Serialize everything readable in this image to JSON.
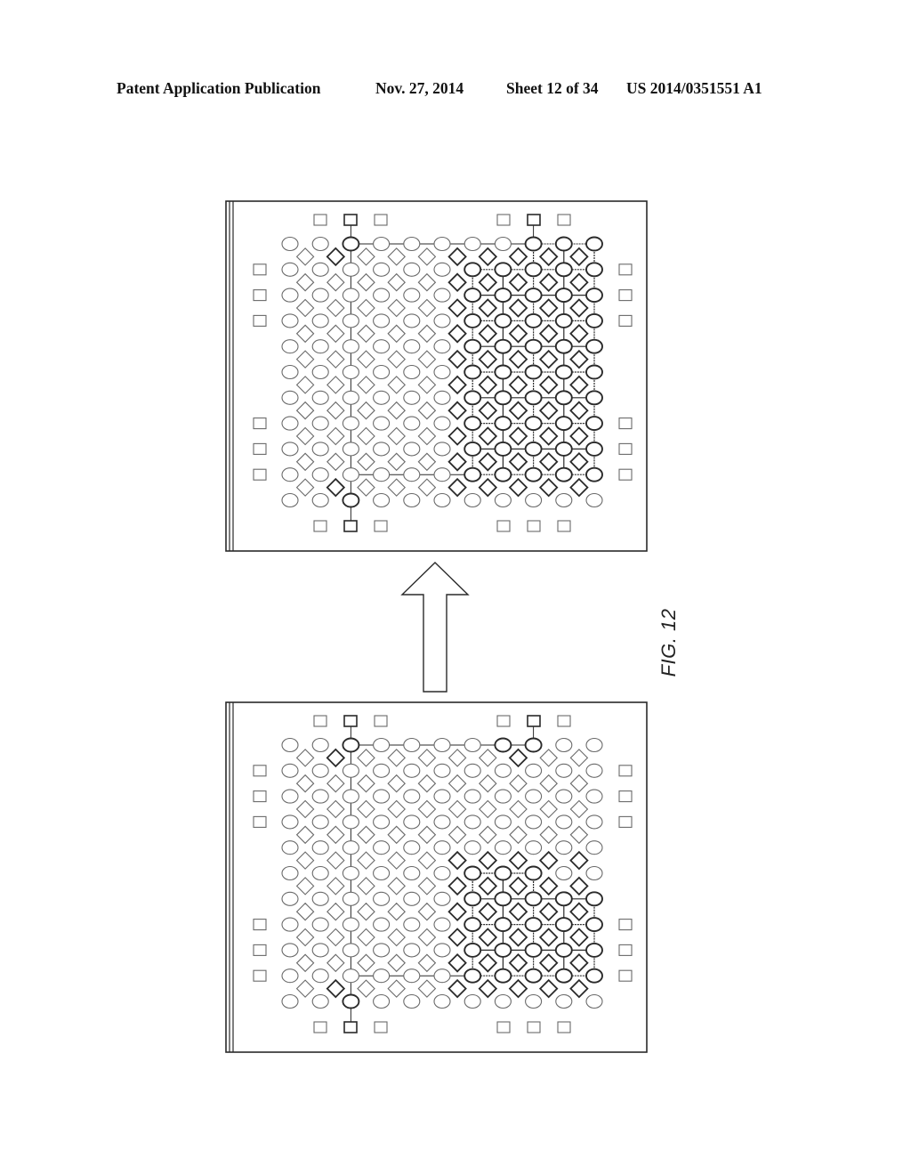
{
  "header": {
    "publication": "Patent Application Publication",
    "date": "Nov. 27, 2014",
    "sheet": "Sheet 12 of 34",
    "number": "US 2014/0351551 A1"
  },
  "figure": {
    "label": "FIG. 12",
    "arrow_direction": "up",
    "arrow_meaning": "lower panel transitions to upper panel",
    "grid": {
      "circle_rows": 11,
      "circle_cols": 11,
      "diamond_rows": 10,
      "diamond_cols": 10,
      "top_pads_left": 3,
      "top_pads_right": 3,
      "bottom_pads_left": 3,
      "bottom_pads_right": 3,
      "side_pad_rows": [
        2,
        3,
        4,
        8,
        9,
        10
      ]
    },
    "panels": [
      {
        "name": "upper-panel",
        "state": "after",
        "bold_circles": [
          [
            1,
            3
          ],
          [
            1,
            9
          ],
          [
            1,
            10
          ],
          [
            1,
            11
          ],
          [
            2,
            7
          ],
          [
            2,
            8
          ],
          [
            2,
            9
          ],
          [
            2,
            10
          ],
          [
            2,
            11
          ],
          [
            3,
            7
          ],
          [
            3,
            8
          ],
          [
            3,
            9
          ],
          [
            3,
            10
          ],
          [
            3,
            11
          ],
          [
            4,
            7
          ],
          [
            4,
            8
          ],
          [
            4,
            9
          ],
          [
            4,
            10
          ],
          [
            4,
            11
          ],
          [
            5,
            7
          ],
          [
            5,
            8
          ],
          [
            5,
            9
          ],
          [
            5,
            10
          ],
          [
            5,
            11
          ],
          [
            6,
            7
          ],
          [
            6,
            8
          ],
          [
            6,
            9
          ],
          [
            6,
            10
          ],
          [
            6,
            11
          ],
          [
            7,
            7
          ],
          [
            7,
            8
          ],
          [
            7,
            9
          ],
          [
            7,
            10
          ],
          [
            7,
            11
          ],
          [
            8,
            7
          ],
          [
            8,
            8
          ],
          [
            8,
            9
          ],
          [
            8,
            10
          ],
          [
            8,
            11
          ],
          [
            9,
            7
          ],
          [
            9,
            8
          ],
          [
            9,
            9
          ],
          [
            9,
            10
          ],
          [
            9,
            11
          ],
          [
            10,
            7
          ],
          [
            10,
            8
          ],
          [
            10,
            9
          ],
          [
            10,
            10
          ],
          [
            10,
            11
          ],
          [
            11,
            3
          ]
        ],
        "mesh_region": {
          "row_from": 2,
          "row_to": 10,
          "col_from": 7,
          "col_to": 11
        },
        "bold_pads_top": [
          2,
          5
        ],
        "bold_pads_bottom": [
          2
        ]
      },
      {
        "name": "lower-panel",
        "state": "before",
        "bold_circles": [
          [
            1,
            3
          ],
          [
            1,
            8
          ],
          [
            1,
            9
          ],
          [
            6,
            7
          ],
          [
            6,
            8
          ],
          [
            6,
            9
          ],
          [
            7,
            7
          ],
          [
            7,
            8
          ],
          [
            7,
            9
          ],
          [
            7,
            10
          ],
          [
            7,
            11
          ],
          [
            8,
            7
          ],
          [
            8,
            8
          ],
          [
            8,
            9
          ],
          [
            8,
            10
          ],
          [
            8,
            11
          ],
          [
            9,
            7
          ],
          [
            9,
            8
          ],
          [
            9,
            9
          ],
          [
            9,
            10
          ],
          [
            9,
            11
          ],
          [
            10,
            7
          ],
          [
            10,
            8
          ],
          [
            10,
            9
          ],
          [
            10,
            10
          ],
          [
            10,
            11
          ],
          [
            11,
            3
          ]
        ],
        "mesh_region": {
          "row_from": 6,
          "row_to": 10,
          "col_from": 7,
          "col_to": 11
        },
        "bold_pads_top": [
          2,
          5
        ],
        "bold_pads_bottom": [
          2
        ]
      }
    ]
  }
}
